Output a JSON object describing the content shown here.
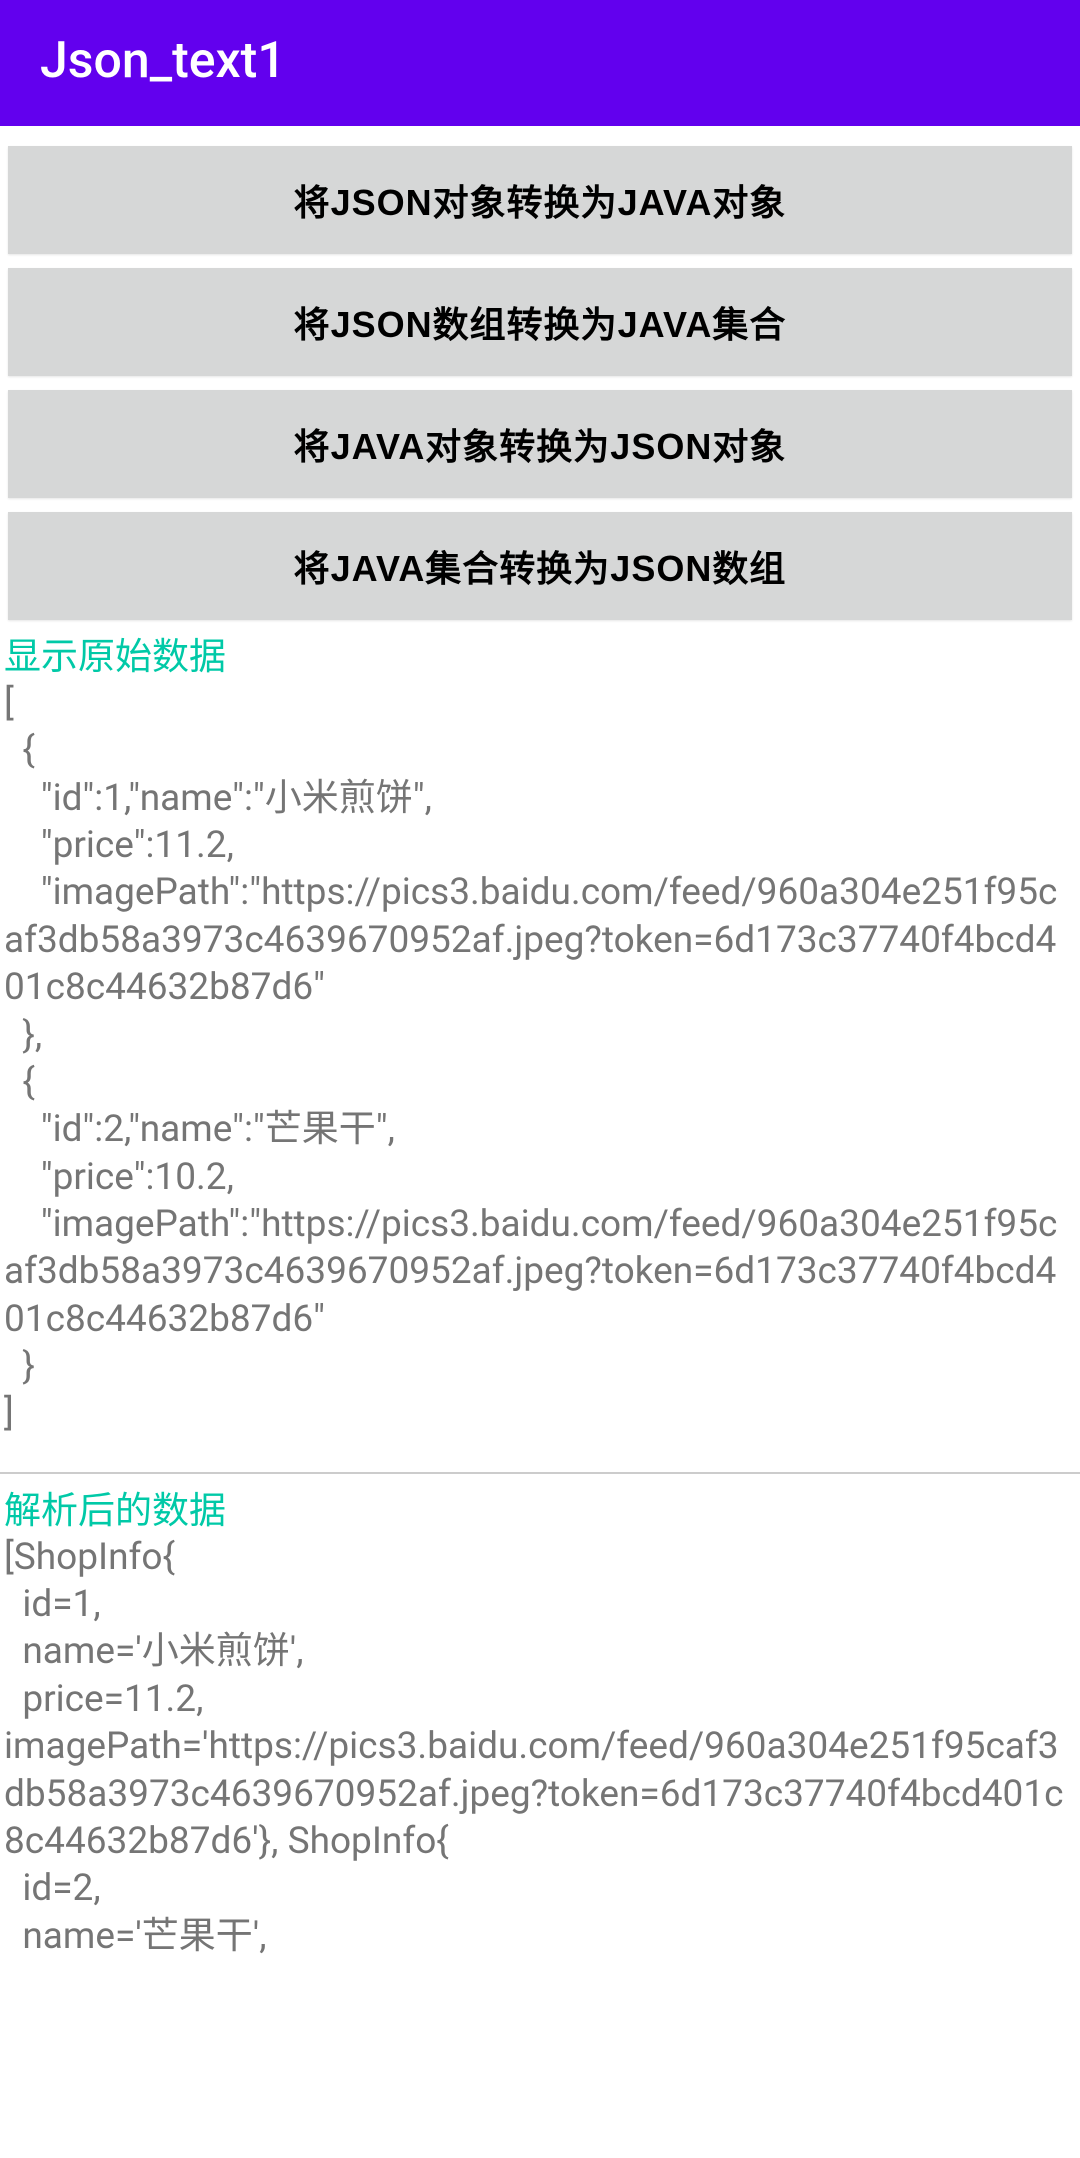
{
  "appbar": {
    "title": "Json_text1"
  },
  "buttons": {
    "json_obj_to_java_obj": "将JSON对象转换为JAVA对象",
    "json_arr_to_java_coll": "将JSON数组转换为JAVA集合",
    "java_obj_to_json_obj": "将JAVA对象转换为JSON对象",
    "java_coll_to_json_arr": "将JAVA集合转换为JSON数组"
  },
  "labels": {
    "raw": "显示原始数据",
    "parsed": "解析后的数据"
  },
  "content": {
    "raw": "[\n  {\n    \"id\":1,\"name\":\"小米煎饼\",\n    \"price\":11.2,\n    \"imagePath\":\"https://pics3.baidu.com/feed/960a304e251f95caf3db58a3973c4639670952af.jpeg?token=6d173c37740f4bcd401c8c44632b87d6\"\n  },\n  {\n    \"id\":2,\"name\":\"芒果干\",\n    \"price\":10.2,\n    \"imagePath\":\"https://pics3.baidu.com/feed/960a304e251f95caf3db58a3973c4639670952af.jpeg?token=6d173c37740f4bcd401c8c44632b87d6\"\n  }\n]",
    "parsed": "[ShopInfo{\n  id=1,\n  name='小米煎饼',\n  price=11.2,\nimagePath='https://pics3.baidu.com/feed/960a304e251f95caf3db58a3973c4639670952af.jpeg?token=6d173c37740f4bcd401c8c44632b87d6'}, ShopInfo{\n  id=2,\n  name='芒果干',"
  }
}
